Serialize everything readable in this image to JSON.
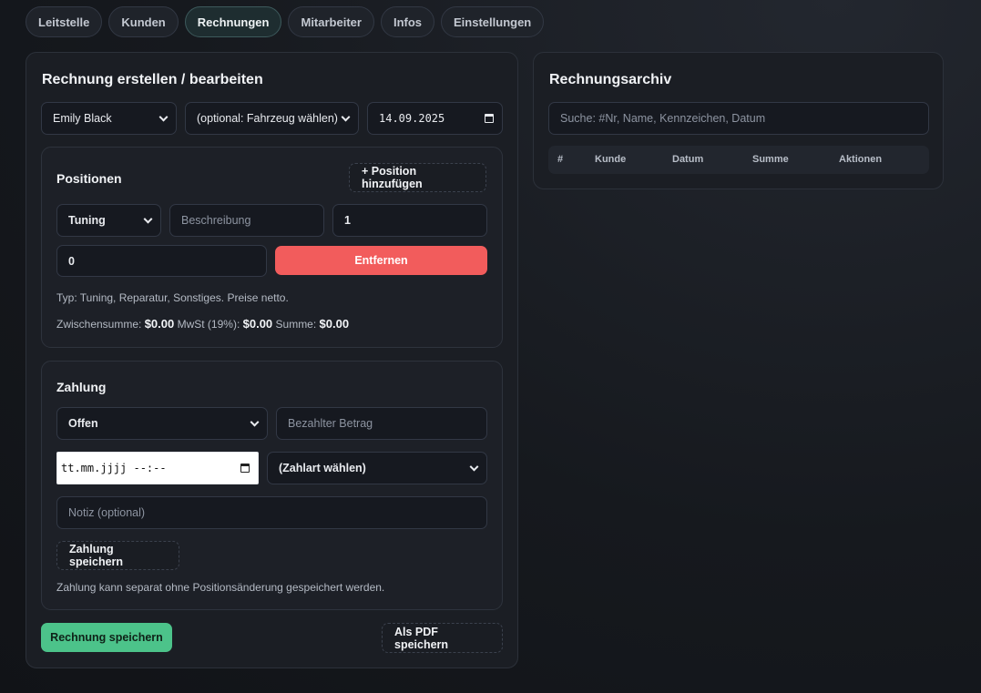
{
  "nav": {
    "tabs": [
      "Leitstelle",
      "Kunden",
      "Rechnungen",
      "Mitarbeiter",
      "Infos",
      "Einstellungen"
    ],
    "active_index": 2
  },
  "invoice": {
    "title": "Rechnung erstellen / bearbeiten",
    "customer": "Emily Black",
    "vehicle": "(optional: Fahrzeug wählen)",
    "date": "14.09.2025",
    "positions": {
      "title": "Positionen",
      "add_button": "+ Position hinzufügen",
      "type": "Tuning",
      "description_placeholder": "Beschreibung",
      "quantity": "1",
      "price": "0",
      "remove_button": "Entfernen",
      "hint": "Typ: Tuning, Reparatur, Sonstiges. Preise netto.",
      "subtotal_label": "Zwischensumme:",
      "subtotal_value": "$0.00",
      "vat_label": "MwSt (19%):",
      "vat_value": "$0.00",
      "sum_label": "Summe:",
      "sum_value": "$0.00"
    },
    "payment": {
      "title": "Zahlung",
      "status": "Offen",
      "paid_amount_placeholder": "Bezahlter Betrag",
      "datetime_placeholder": "tt.mm.jjjj --:--",
      "method": "(Zahlart wählen)",
      "note_placeholder": "Notiz (optional)",
      "save_button": "Zahlung speichern",
      "hint": "Zahlung kann separat ohne Positionsänderung gespeichert werden."
    },
    "save_button": "Rechnung speichern",
    "pdf_button": "Als PDF speichern"
  },
  "archive": {
    "title": "Rechnungsarchiv",
    "search_placeholder": "Suche: #Nr, Name, Kennzeichen, Datum",
    "columns": [
      "#",
      "Kunde",
      "Datum",
      "Summe",
      "Aktionen"
    ]
  },
  "colors": {
    "accent_green": "#4cc38a",
    "danger_red": "#f25c5c",
    "active_tab": "#1e2d30"
  }
}
